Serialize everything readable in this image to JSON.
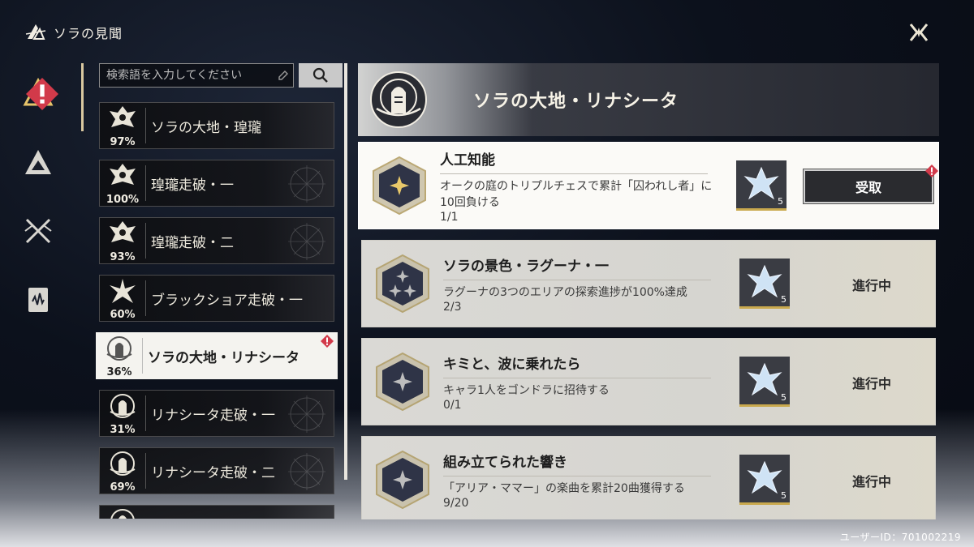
{
  "header": {
    "title": "ソラの見聞",
    "logo_icon": "game-logo-icon",
    "close_icon": "close-icon"
  },
  "nav": {
    "items": [
      {
        "icon": "achievement-triangle-icon",
        "active": true,
        "badge": true
      },
      {
        "icon": "mountain-icon",
        "active": false,
        "badge": false
      },
      {
        "icon": "crossed-swords-icon",
        "active": false,
        "badge": false
      },
      {
        "icon": "book-icon",
        "active": false,
        "badge": false
      }
    ]
  },
  "search": {
    "placeholder": "検索語を入力してください",
    "button_icon": "search-icon"
  },
  "list": {
    "items": [
      {
        "label": "ソラの大地・瑝瓏",
        "percent": "97%",
        "icon": "dragon-emblem-icon",
        "active": false,
        "badge": false
      },
      {
        "label": "瑝瓏走破・一",
        "percent": "100%",
        "icon": "dragon-emblem-icon",
        "active": false,
        "badge": false
      },
      {
        "label": "瑝瓏走破・二",
        "percent": "93%",
        "icon": "dragon-emblem-icon",
        "active": false,
        "badge": false
      },
      {
        "label": "ブラックショア走破・一",
        "percent": "60%",
        "icon": "star-flower-icon",
        "active": false,
        "badge": false
      },
      {
        "label": "ソラの大地・リナシータ",
        "percent": "36%",
        "icon": "rinascita-emblem-icon",
        "active": true,
        "badge": true
      },
      {
        "label": "リナシータ走破・一",
        "percent": "31%",
        "icon": "rinascita-emblem-icon",
        "active": false,
        "badge": false
      },
      {
        "label": "リナシータ走破・二",
        "percent": "69%",
        "icon": "rinascita-emblem-icon",
        "active": false,
        "badge": false
      },
      {
        "label": "",
        "percent": "",
        "icon": "rinascita-emblem-icon",
        "active": false,
        "badge": false
      }
    ]
  },
  "banner": {
    "title": "ソラの大地・リナシータ",
    "emblem_icon": "rinascita-emblem-icon"
  },
  "tasks": [
    {
      "title": "人工知能",
      "desc": "オークの庭のトリプルチェスで累計「囚われし者」に10回負ける",
      "progress": "1/1",
      "reward_count": "5",
      "status": "受取",
      "claimable": true,
      "hex_icon": "single-star-hex-icon"
    },
    {
      "title": "ソラの景色・ラグーナ・一",
      "desc": "ラグーナの3つのエリアの探索進捗が100%達成",
      "progress": "2/3",
      "reward_count": "5",
      "status": "進行中",
      "claimable": false,
      "hex_icon": "triple-star-hex-icon"
    },
    {
      "title": "キミと、波に乗れたら",
      "desc": "キャラ1人をゴンドラに招待する",
      "progress": "0/1",
      "reward_count": "5",
      "status": "進行中",
      "claimable": false,
      "hex_icon": "single-star-hex-icon"
    },
    {
      "title": "組み立てられた響き",
      "desc": "「アリア・ママー」の楽曲を累計20曲獲得する",
      "progress": "9/20",
      "reward_count": "5",
      "status": "進行中",
      "claimable": false,
      "hex_icon": "single-star-hex-icon"
    }
  ],
  "reward_icon": "astrite-crystal-icon",
  "footer": {
    "user_id": "ユーザーID：701002219"
  },
  "colors": {
    "gold": "#c9a94e",
    "badge_red": "#d23a4a",
    "active_item_bg": "#f4f3ef"
  }
}
